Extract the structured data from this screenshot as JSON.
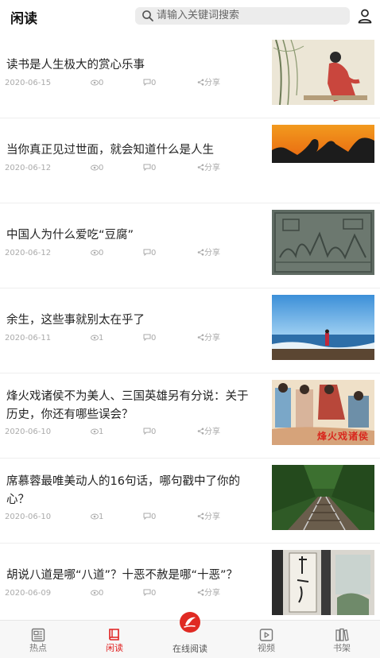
{
  "header": {
    "title": "闲读",
    "search_placeholder": "请输入关键词搜索"
  },
  "articles": [
    {
      "title": "读书是人生极大的赏心乐事",
      "date": "2020-06-15",
      "views": "0",
      "comments": "0",
      "share": "分享",
      "image": "traditional-painting-woman"
    },
    {
      "title": "当你真正见过世面，就会知道什么是人生",
      "date": "2020-06-12",
      "views": "0",
      "comments": "0",
      "share": "分享",
      "image": "sunset-heart-hands-with-text"
    },
    {
      "title": "中国人为什么爱吃“豆腐”",
      "date": "2020-06-12",
      "views": "0",
      "comments": "0",
      "share": "分享",
      "image": "stone-relief-rubbing"
    },
    {
      "title": "余生，这些事就别太在乎了",
      "date": "2020-06-11",
      "views": "1",
      "comments": "0",
      "share": "分享",
      "image": "seaside-person-blue-sky"
    },
    {
      "title": "烽火戏诸侯不为美人、三国英雄另有分说：关于历史，你还有哪些误会？",
      "date": "2020-06-10",
      "views": "1",
      "comments": "0",
      "share": "分享",
      "image": "illustration-beacon-fire",
      "image_caption": "烽火戏诸侯"
    },
    {
      "title": "席慕蓉最唯美动人的16句话，哪句戳中了你的心？",
      "date": "2020-06-10",
      "views": "1",
      "comments": "0",
      "share": "分享",
      "image": "railway-in-forest"
    },
    {
      "title": "胡说八道是哪“八道”？十恶不赦是哪“十恶”？",
      "date": "2020-06-09",
      "views": "0",
      "comments": "0",
      "share": "分享",
      "image": "calligraphy-room"
    }
  ],
  "bottom_nav": [
    {
      "label": "热点",
      "icon": "newspaper-icon",
      "active": false
    },
    {
      "label": "闲读",
      "icon": "book-icon",
      "active": true
    },
    {
      "label": "在线阅读",
      "icon": "online-reading-icon",
      "active": false
    },
    {
      "label": "视频",
      "icon": "video-icon",
      "active": false
    },
    {
      "label": "书架",
      "icon": "bookshelf-icon",
      "active": false
    }
  ],
  "colors": {
    "accent": "#e02020",
    "meta": "#aaaaaa",
    "search_bg": "#ececec"
  }
}
